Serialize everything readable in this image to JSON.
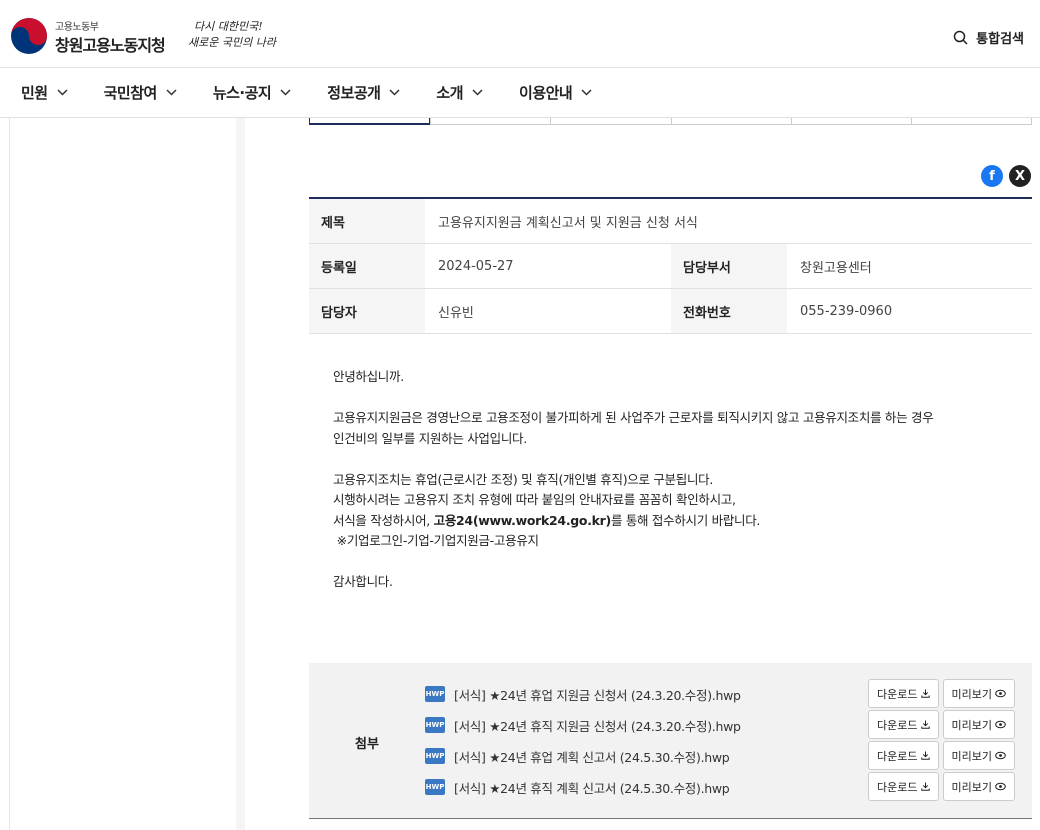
{
  "header": {
    "ministry": "고용노동부",
    "office": "창원고용노동지청",
    "slogan_line1": "다시 대한민국!",
    "slogan_line2": "새로운 국민의 나라",
    "search_label": "통합검색"
  },
  "nav": [
    "민원",
    "국민참여",
    "뉴스·공지",
    "정보공개",
    "소개",
    "이용안내"
  ],
  "share": {
    "facebook": "f",
    "x": "X"
  },
  "info": {
    "title_label": "제목",
    "title": "고용유지지원금 계획신고서 및 지원금 신청 서식",
    "date_label": "등록일",
    "date": "2024-05-27",
    "dept_label": "담당부서",
    "dept": "창원고용센터",
    "person_label": "담당자",
    "person": "신유빈",
    "phone_label": "전화번호",
    "phone": "055-239-0960"
  },
  "content": {
    "greeting": "안녕하십니까.",
    "p1_l1": "고용유지지원금은 경영난으로 고용조정이 불가피하게 된 사업주가 근로자를 퇴직시키지 않고 고용유지조치를 하는 경우",
    "p1_l2": "인건비의 일부를 지원하는 사업입니다.",
    "p2_l1": "고용유지조치는 휴업(근로시간 조정) 및 휴직(개인별 휴직)으로 구분됩니다.",
    "p2_l2": "시행하시려는 고용유지 조치 유형에 따라 붙임의 안내자료를 꼼꼼히 확인하시고,",
    "p2_l3_pre": "서식을 작성하시어, ",
    "p2_l3_bold": "고용24(www.work24.go.kr)",
    "p2_l3_post": "를 통해 접수하시기 바랍니다.",
    "p2_l4": " ※기업로그인-기업-기업지원금-고용유지",
    "closing": "감사합니다."
  },
  "attach": {
    "label": "첨부",
    "download": "다운로드",
    "preview": "미리보기",
    "hwp_badge": "HWP",
    "files": [
      "[서식] ★24년 휴업 지원금 신청서 (24.3.20.수정).hwp",
      "[서식] ★24년 휴직 지원금 신청서 (24.3.20.수정).hwp",
      "[서식] ★24년 휴업 계획 신고서 (24.5.30.수정).hwp",
      "[서식] ★24년 휴직 계획 신고서 (24.5.30.수정).hwp"
    ]
  },
  "colors": {
    "navy": "#1e2e5c",
    "facebook": "#1877f2",
    "emblem_red": "#c8102e",
    "emblem_blue": "#003478"
  }
}
